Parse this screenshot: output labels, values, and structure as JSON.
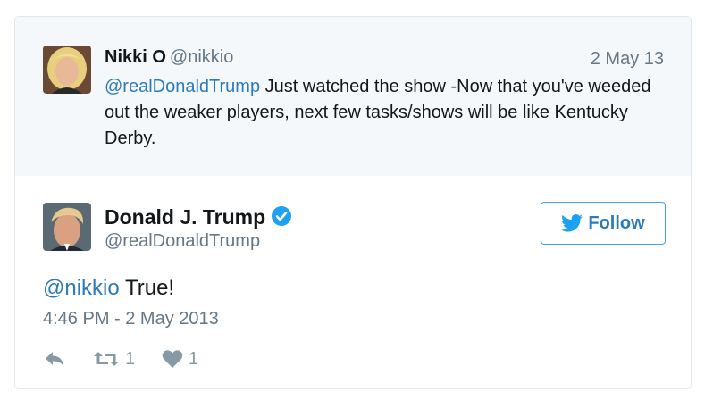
{
  "parent_tweet": {
    "name": "Nikki O",
    "handle": "@nikkio",
    "date": "2 May 13",
    "mention": "@realDonaldTrump",
    "text": " Just watched the show -Now that you've weeded out the weaker players, next few tasks/shows will be like Kentucky Derby."
  },
  "main_tweet": {
    "name": "Donald J. Trump",
    "handle": "@realDonaldTrump",
    "follow_label": "Follow",
    "mention": "@nikkio",
    "text": " True!",
    "timestamp": "4:46 PM - 2 May 2013",
    "retweet_count": "1",
    "like_count": "1"
  },
  "colors": {
    "link": "#2b7bb9",
    "secondary_text": "#657786",
    "verified": "#1da1f2",
    "action_gray": "#8899a6"
  },
  "icons": {
    "reply": "reply-icon",
    "retweet": "retweet-icon",
    "like": "heart-icon",
    "verified": "verified-badge-icon",
    "follow": "bird-icon"
  }
}
